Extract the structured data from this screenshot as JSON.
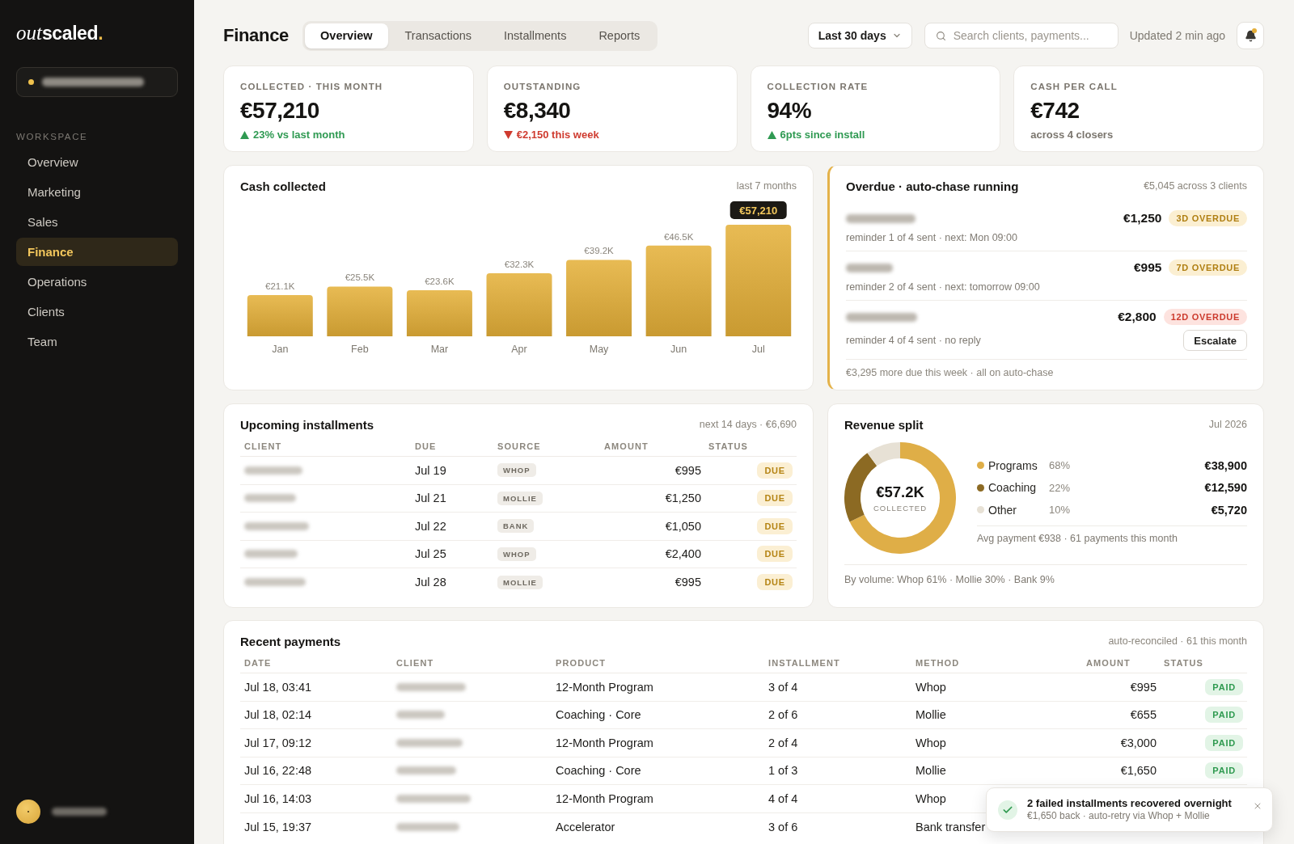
{
  "sidebar": {
    "logo": {
      "italic": "out",
      "bold": "scaled",
      "accent": "."
    },
    "workspace": {
      "redacted": true
    },
    "section_label": "WORKSPACE",
    "items": [
      {
        "label": "Overview",
        "selected": false
      },
      {
        "label": "Marketing",
        "selected": false
      },
      {
        "label": "Sales",
        "selected": false
      },
      {
        "label": "Finance",
        "selected": true
      },
      {
        "label": "Operations",
        "selected": false
      },
      {
        "label": "Clients",
        "selected": false
      },
      {
        "label": "Team",
        "selected": false
      }
    ],
    "user": {
      "redacted": true
    }
  },
  "header": {
    "title": "Finance",
    "tabs": [
      {
        "label": "Overview",
        "selected": true
      },
      {
        "label": "Transactions",
        "selected": false
      },
      {
        "label": "Installments",
        "selected": false
      },
      {
        "label": "Reports",
        "selected": false
      }
    ],
    "date_range": "Last 30 days",
    "search": {
      "placeholder": "Search clients, payments..."
    },
    "updated": "Updated 2 min ago",
    "notifications": {
      "unread": true
    }
  },
  "kpis": [
    {
      "label": "COLLECTED · THIS MONTH",
      "value": "€57,210",
      "kind": "up",
      "delta": "23% vs last month"
    },
    {
      "label": "OUTSTANDING",
      "value": "€8,340",
      "kind": "down",
      "delta": "€2,150 this week"
    },
    {
      "label": "COLLECTION RATE",
      "value": "94%",
      "kind": "up",
      "delta": "6pts since install"
    },
    {
      "label": "CASH PER CALL",
      "value": "€742",
      "kind": "neutral",
      "delta": "across 4 closers"
    }
  ],
  "cash_collected": {
    "title": "Cash collected",
    "period": "last 7 months",
    "chart_data": {
      "type": "bar",
      "categories": [
        "Jan",
        "Feb",
        "Mar",
        "Apr",
        "May",
        "Jun",
        "Jul"
      ],
      "values": [
        21100,
        25500,
        23600,
        32300,
        39200,
        46500,
        57210
      ],
      "value_labels": [
        "€21.1K",
        "€25.5K",
        "€23.6K",
        "€32.3K",
        "€39.2K",
        "€46.5K",
        "€57,210"
      ]
    }
  },
  "overdue": {
    "title": "Overdue · auto-chase running",
    "summary": "€5,045 across 3 clients",
    "items": [
      {
        "name_redacted": true,
        "amount": "€1,250",
        "badge": "3D OVERDUE",
        "kind": "warning",
        "note": "reminder 1 of 4 sent · next: Mon 09:00"
      },
      {
        "name_redacted": true,
        "amount": "€995",
        "badge": "7D OVERDUE",
        "kind": "warning",
        "note": "reminder 2 of 4 sent · next: tomorrow 09:00"
      },
      {
        "name_redacted": true,
        "amount": "€2,800",
        "badge": "12D OVERDUE",
        "kind": "critical",
        "note": "reminder 4 of 4 sent · no reply",
        "action": "Escalate"
      }
    ],
    "footer": "€3,295 more due this week · all on auto-chase"
  },
  "upcoming": {
    "title": "Upcoming installments",
    "summary": "next 14 days · €6,690",
    "columns": [
      "CLIENT",
      "DUE",
      "SOURCE",
      "AMOUNT",
      "STATUS"
    ],
    "rows": [
      {
        "client_redacted": true,
        "due": "Jul 19",
        "source": "WHOP",
        "amount": "€995",
        "status": "DUE"
      },
      {
        "client_redacted": true,
        "due": "Jul 21",
        "source": "MOLLIE",
        "amount": "€1,250",
        "status": "DUE"
      },
      {
        "client_redacted": true,
        "due": "Jul 22",
        "source": "BANK",
        "amount": "€1,050",
        "status": "DUE"
      },
      {
        "client_redacted": true,
        "due": "Jul 25",
        "source": "WHOP",
        "amount": "€2,400",
        "status": "DUE"
      },
      {
        "client_redacted": true,
        "due": "Jul 28",
        "source": "MOLLIE",
        "amount": "€995",
        "status": "DUE"
      }
    ]
  },
  "revenue_split": {
    "title": "Revenue split",
    "period": "Jul 2026",
    "chart_data": {
      "type": "donut",
      "categories": [
        "Programs",
        "Coaching",
        "Other"
      ],
      "values": [
        68,
        22,
        10
      ]
    },
    "center_value": "€57.2K",
    "center_label": "COLLECTED",
    "legend": [
      {
        "share": "68%",
        "amount": "€38,900",
        "color": "#dfae47"
      },
      {
        "share": "22%",
        "amount": "€12,590",
        "color": "#8c6a23"
      },
      {
        "share": "10%",
        "amount": "€5,720",
        "color": "#e7e1d5"
      }
    ],
    "average": "Avg payment €938 · 61 payments this month",
    "volume": "By volume: Whop 61% · Mollie 30% · Bank 9%"
  },
  "recent_payments": {
    "title": "Recent payments",
    "summary": "auto-reconciled · 61 this month",
    "columns": [
      "DATE",
      "CLIENT",
      "PRODUCT",
      "INSTALLMENT",
      "METHOD",
      "AMOUNT",
      "STATUS"
    ],
    "rows": [
      {
        "date": "Jul 18, 03:41",
        "client_redacted": true,
        "product": "12-Month Program",
        "installment": "3 of 4",
        "method": "Whop",
        "amount": "€995",
        "status": "PAID"
      },
      {
        "date": "Jul 18, 02:14",
        "client_redacted": true,
        "product": "Coaching · Core",
        "installment": "2 of 6",
        "method": "Mollie",
        "amount": "€655",
        "status": "PAID"
      },
      {
        "date": "Jul 17, 09:12",
        "client_redacted": true,
        "product": "12-Month Program",
        "installment": "2 of 4",
        "method": "Whop",
        "amount": "€3,000",
        "status": "PAID"
      },
      {
        "date": "Jul 16, 22:48",
        "client_redacted": true,
        "product": "Coaching · Core",
        "installment": "1 of 3",
        "method": "Mollie",
        "amount": "€1,650",
        "status": "PAID"
      },
      {
        "date": "Jul 16, 14:03",
        "client_redacted": true,
        "product": "12-Month Program",
        "installment": "4 of 4",
        "method": "Whop"
      },
      {
        "date": "Jul 15, 19:37",
        "client_redacted": true,
        "product": "Accelerator",
        "installment": "3 of 6",
        "method": "Bank transfer"
      }
    ]
  },
  "toast": {
    "title": "2 failed installments recovered overnight",
    "message": "€1,650 back · auto-retry via Whop + Mollie"
  }
}
